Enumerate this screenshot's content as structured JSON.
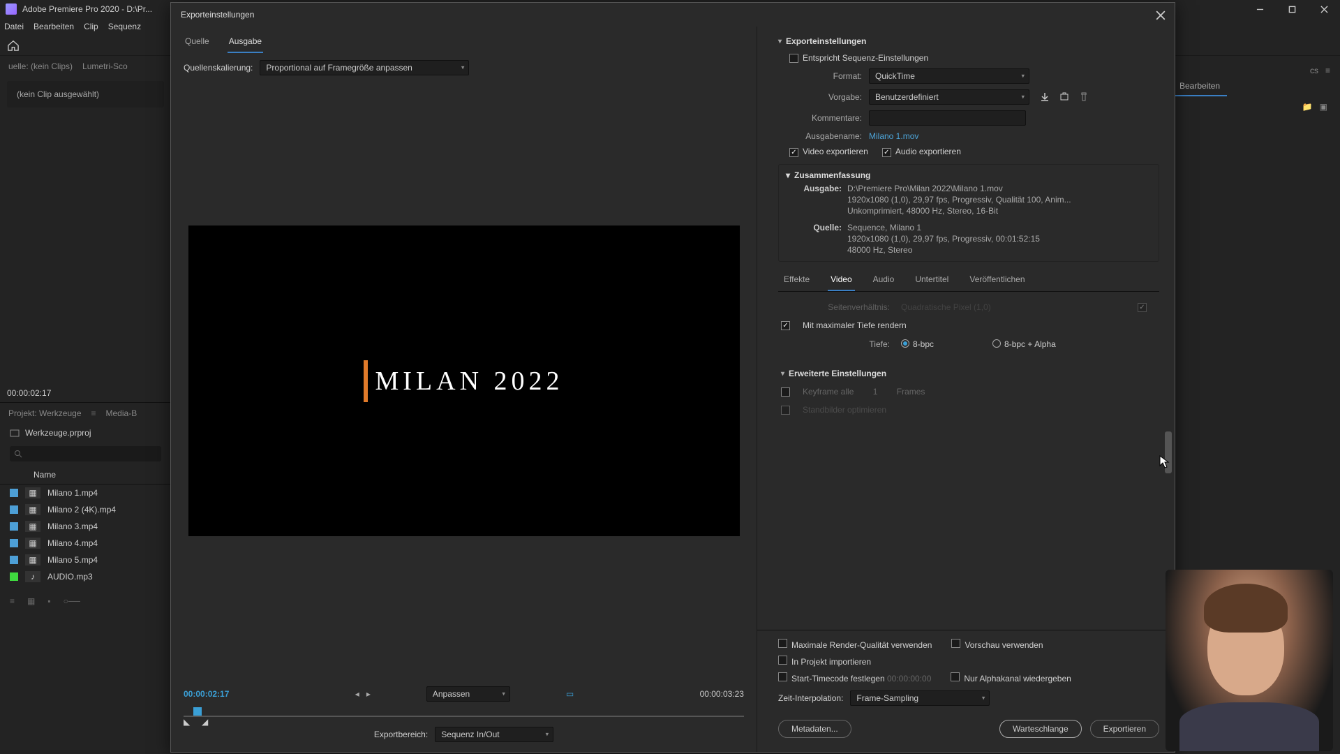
{
  "app": {
    "title": "Adobe Premiere Pro 2020 - D:\\Pr...",
    "menu": [
      "Datei",
      "Bearbeiten",
      "Clip",
      "Sequenz"
    ]
  },
  "bg": {
    "source_tab": "uelle: (kein Clips)",
    "lumetri": "Lumetri-Sco",
    "no_clip": "(kein Clip ausgewählt)",
    "timecode": "00:00:02:17",
    "project_panel_tabs": [
      "Projekt: Werkzeuge",
      "Media-B"
    ],
    "project_name": "Werkzeuge.prproj",
    "name_col": "Name",
    "files": [
      "Milano 1.mp4",
      "Milano 2 (4K).mp4",
      "Milano 3.mp4",
      "Milano 4.mp4",
      "Milano 5.mp4",
      "AUDIO.mp3"
    ],
    "right_tab": "Bearbeiten"
  },
  "dialog": {
    "title": "Exporteinstellungen",
    "left": {
      "tab_source": "Quelle",
      "tab_output": "Ausgabe",
      "scale_label": "Quellenskalierung:",
      "scale_value": "Proportional auf Framegröße anpassen",
      "preview_title": "Milan 2022",
      "tc_left": "00:00:02:17",
      "fit_label": "Anpassen",
      "tc_right": "00:00:03:23",
      "range_label": "Exportbereich:",
      "range_value": "Sequenz In/Out"
    },
    "right": {
      "section_title": "Exporteinstellungen",
      "match_sequence": "Entspricht Sequenz-Einstellungen",
      "format_label": "Format:",
      "format_value": "QuickTime",
      "preset_label": "Vorgabe:",
      "preset_value": "Benutzerdefiniert",
      "comments_label": "Kommentare:",
      "outputname_label": "Ausgabename:",
      "outputname_value": "Milano 1.mov",
      "export_video": "Video exportieren",
      "export_audio": "Audio exportieren",
      "summary_title": "Zusammenfassung",
      "summary_output_label": "Ausgabe:",
      "summary_output_l1": "D:\\Premiere Pro\\Milan 2022\\Milano 1.mov",
      "summary_output_l2": "1920x1080 (1,0), 29,97 fps, Progressiv, Qualität 100, Anim...",
      "summary_output_l3": "Unkomprimiert, 48000 Hz, Stereo, 16-Bit",
      "summary_source_label": "Quelle:",
      "summary_source_l1": "Sequence, Milano 1",
      "summary_source_l2": "1920x1080 (1,0), 29,97 fps, Progressiv, 00:01:52:15",
      "summary_source_l3": "48000 Hz, Stereo",
      "tabs": [
        "Effekte",
        "Video",
        "Audio",
        "Untertitel",
        "Veröffentlichen"
      ],
      "aspect_label_partial": "Seitenverhältnis:",
      "aspect_value_partial": "Quadratische Pixel (1,0)",
      "max_depth": "Mit maximaler Tiefe rendern",
      "depth_label": "Tiefe:",
      "depth_opt1": "8-bpc",
      "depth_opt2": "8-bpc + Alpha",
      "advanced_title": "Erweiterte Einstellungen",
      "keyframe_all": "Keyframe alle",
      "keyframe_num": "1",
      "keyframe_frames": "Frames",
      "optimize_stills": "Standbilder optimieren",
      "max_render": "Maximale Render-Qualität verwenden",
      "use_preview": "Vorschau verwenden",
      "import_project": "In Projekt importieren",
      "start_tc": "Start-Timecode festlegen",
      "start_tc_val": "00:00:00:00",
      "alpha_only": "Nur Alphakanal wiedergeben",
      "interp_label": "Zeit-Interpolation:",
      "interp_value": "Frame-Sampling",
      "btn_metadata": "Metadaten...",
      "btn_queue": "Warteschlange",
      "btn_export": "Exportieren"
    }
  }
}
